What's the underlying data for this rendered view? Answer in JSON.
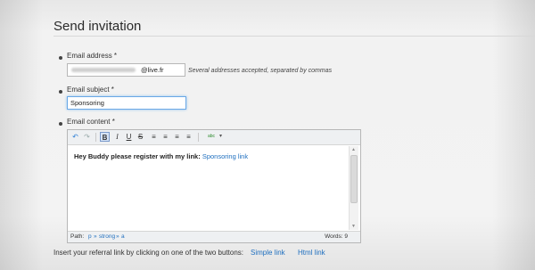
{
  "page": {
    "title": "Send invitation"
  },
  "form": {
    "email_address": {
      "label": "Email address *",
      "value_suffix": "@live.fr",
      "hint": "Several addresses accepted, separated by commas"
    },
    "email_subject": {
      "label": "Email subject *",
      "value": "Sponsoring"
    },
    "email_content": {
      "label": "Email content *"
    }
  },
  "editor": {
    "toolbar": {
      "undo": "↶",
      "redo": "↷",
      "bold": "B",
      "italic": "I",
      "underline": "U",
      "strike": "S",
      "align_left": "≡",
      "align_center": "≡",
      "align_right": "≡",
      "justify": "≡",
      "spellcheck": "abc"
    },
    "content": {
      "bold_text": "Hey Buddy please register with my link:",
      "link_text": "Sponsoring link"
    },
    "status": {
      "path_label": "Path:",
      "path_p": "p",
      "path_sep1": "»",
      "path_strong": "strong",
      "path_sep2": "»",
      "path_a": "a",
      "words": "Words: 9"
    }
  },
  "footer": {
    "text": "Insert your referral link by clicking on one of the two buttons:",
    "simple_link": "Simple link",
    "html_link": "Html link"
  }
}
